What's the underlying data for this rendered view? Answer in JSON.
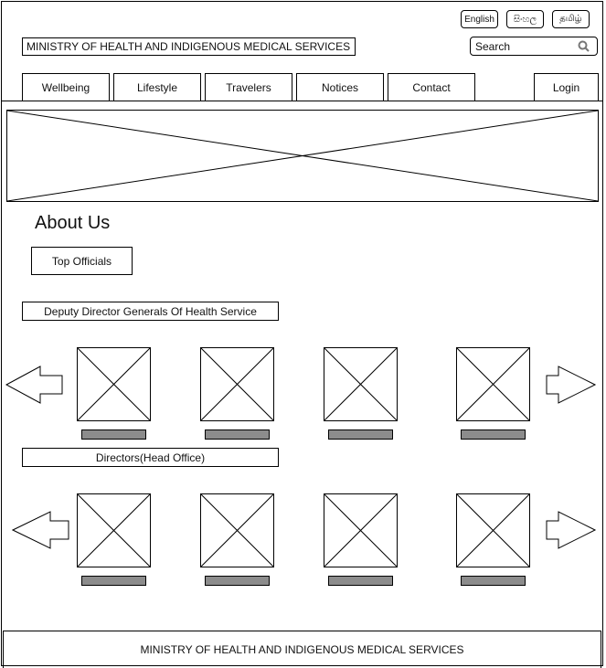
{
  "header": {
    "site_title": "MINISTRY OF HEALTH AND INDIGENOUS MEDICAL SERVICES",
    "languages": [
      "English",
      "සිංහල",
      "தமிழ்"
    ],
    "search": {
      "value": "Search",
      "icon": "search-icon"
    }
  },
  "nav": {
    "tabs": [
      "Wellbeing",
      "Lifestyle",
      "Travelers",
      "Notices",
      "Contact"
    ],
    "login_label": "Login"
  },
  "banner": {
    "icon": "image-placeholder-icon"
  },
  "about": {
    "heading": "About Us",
    "top_officials_label": "Top Officials",
    "sections": [
      {
        "title": "Deputy Director Generals Of Health Service",
        "officials_count": 4
      },
      {
        "title": "Directors(Head Office)",
        "officials_count": 4
      }
    ],
    "carousel_icons": {
      "prev": "arrow-left-icon",
      "next": "arrow-right-icon"
    }
  },
  "footer": {
    "text": "MINISTRY OF HEALTH AND INDIGENOUS MEDICAL SERVICES"
  }
}
